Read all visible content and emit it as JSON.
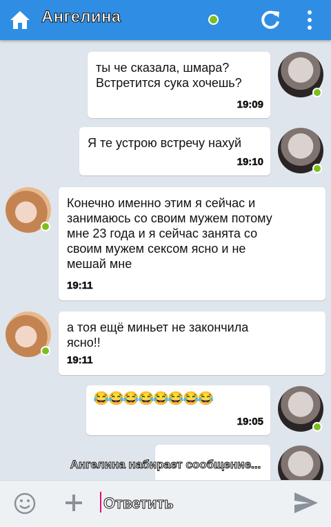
{
  "header": {
    "title": "Ангелина",
    "online_color": "#7cbf1f",
    "bar_color": "#2f8ee3"
  },
  "messages": [
    {
      "id": 1,
      "sender": "me",
      "lines": [
        "ты че сказала, шмара?",
        "Встретится сука хочешь?"
      ],
      "time": "19:09"
    },
    {
      "id": 2,
      "sender": "me",
      "lines": [
        "Я те устрою встречу нахуй"
      ],
      "time": "19:10"
    },
    {
      "id": 3,
      "sender": "her",
      "lines": [
        "Конечно именно этим я сейчас и",
        "занимаюсь со своим мужем потому",
        "мне 23 года и я сейчас занята со",
        "своим мужем сексом ясно и не",
        "мешай мне"
      ],
      "time": "19:11"
    },
    {
      "id": 4,
      "sender": "her",
      "lines": [
        "а тоя ещё миньет не закончила",
        "ясно!!"
      ],
      "time": "19:11"
    },
    {
      "id": 5,
      "sender": "me",
      "lines": [
        "😂😂😂😂😂😂😂😂"
      ],
      "time": "19:05"
    }
  ],
  "typing_status": "Ангелина набирает сообщение...",
  "composer": {
    "placeholder": "Ответить"
  },
  "icons": [
    "home-icon",
    "refresh-icon",
    "more-icon",
    "emoji-icon",
    "plus-icon",
    "send-icon"
  ]
}
